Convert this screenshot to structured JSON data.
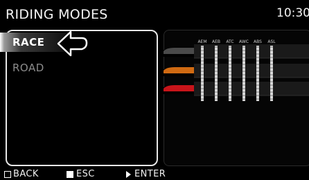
{
  "header": {
    "title": "RIDING MODES",
    "clock": "10:30"
  },
  "menu": {
    "items": [
      {
        "label": "RACE",
        "selected": true
      },
      {
        "label": "ROAD",
        "selected": false
      }
    ]
  },
  "settings_table": {
    "columns": [
      "AEM",
      "AEB",
      "ATC",
      "AWC",
      "ABS",
      "ASL"
    ],
    "rows": [
      {
        "color": "#4a4a4a"
      },
      {
        "color": "#d06a12"
      },
      {
        "color": "#c8141a"
      }
    ]
  },
  "footer": {
    "back": "BACK",
    "esc": "ESC",
    "enter": "ENTER"
  }
}
